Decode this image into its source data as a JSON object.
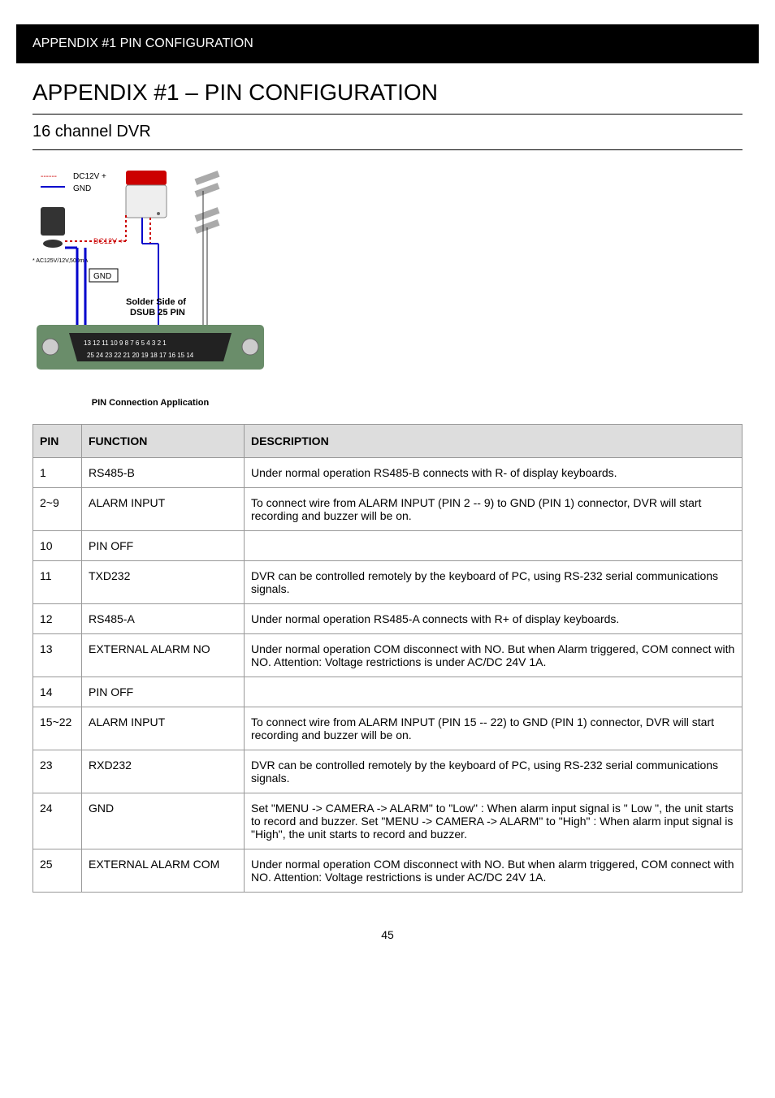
{
  "header": {
    "title": "APPENDIX #1 PIN CONFIGURATION"
  },
  "appendix_title": "APPENDIX #1 – PIN CONFIGURATION",
  "section_title": "16 channel DVR",
  "diagram": {
    "legend_dc12v": "DC12V +",
    "legend_gnd": "GND",
    "dc12v_label": "DC12V +",
    "gnd_label": "GND",
    "adapter_label": "* AC125V/12V,500mA",
    "solder_text": "Solder Side of\nDSUB 25 PIN",
    "pin_top": "13 12 11 10 9 8 7 6 5 4 3 2 1",
    "pin_bottom": "25 24 23 22 21 20 19 18 17 16 15 14",
    "caption": "PIN Connection Application"
  },
  "table": {
    "headers": {
      "pin": "PIN",
      "function": "FUNCTION",
      "description": "DESCRIPTION"
    },
    "rows": [
      {
        "pin": "1",
        "function": "RS485-B",
        "description": "Under normal operation RS485-B connects with R- of display keyboards."
      },
      {
        "pin": "2~9",
        "function": "ALARM INPUT",
        "description": "To connect wire from ALARM INPUT (PIN 2 -- 9) to GND (PIN 1) connector, DVR will start recording and buzzer will be on."
      },
      {
        "pin": "10",
        "function": "PIN OFF",
        "description": ""
      },
      {
        "pin": "11",
        "function": "TXD232",
        "description": "DVR can be controlled remotely by the keyboard of PC, using RS-232 serial communications signals."
      },
      {
        "pin": "12",
        "function": "RS485-A",
        "description": "Under normal operation RS485-A connects with R+ of display keyboards."
      },
      {
        "pin": "13",
        "function": "EXTERNAL ALARM NO",
        "description": "Under normal operation COM disconnect with NO. But when Alarm triggered, COM connect with NO.\nAttention: Voltage restrictions is under AC/DC 24V 1A."
      },
      {
        "pin": "14",
        "function": "PIN OFF",
        "description": ""
      },
      {
        "pin": "15~22",
        "function": "ALARM INPUT",
        "description": "To connect wire from ALARM INPUT (PIN 15 -- 22) to GND (PIN 1) connector, DVR will start recording and buzzer will be on."
      },
      {
        "pin": "23",
        "function": "RXD232",
        "description": "DVR can be controlled remotely by the keyboard of PC, using RS-232 serial communications signals."
      },
      {
        "pin": "24",
        "function": "GND",
        "description": "Set \"MENU -> CAMERA -> ALARM\" to \"Low\" : When alarm input signal is \" Low \", the unit starts to record and buzzer.\nSet \"MENU -> CAMERA -> ALARM\" to \"High\" : When alarm input signal is \"High\", the unit starts to record and buzzer."
      },
      {
        "pin": "25",
        "function": "EXTERNAL ALARM COM",
        "description": "Under normal operation COM disconnect with NO. But when alarm triggered, COM connect with NO.\nAttention: Voltage restrictions is under AC/DC 24V 1A."
      }
    ]
  },
  "page_number": "45"
}
